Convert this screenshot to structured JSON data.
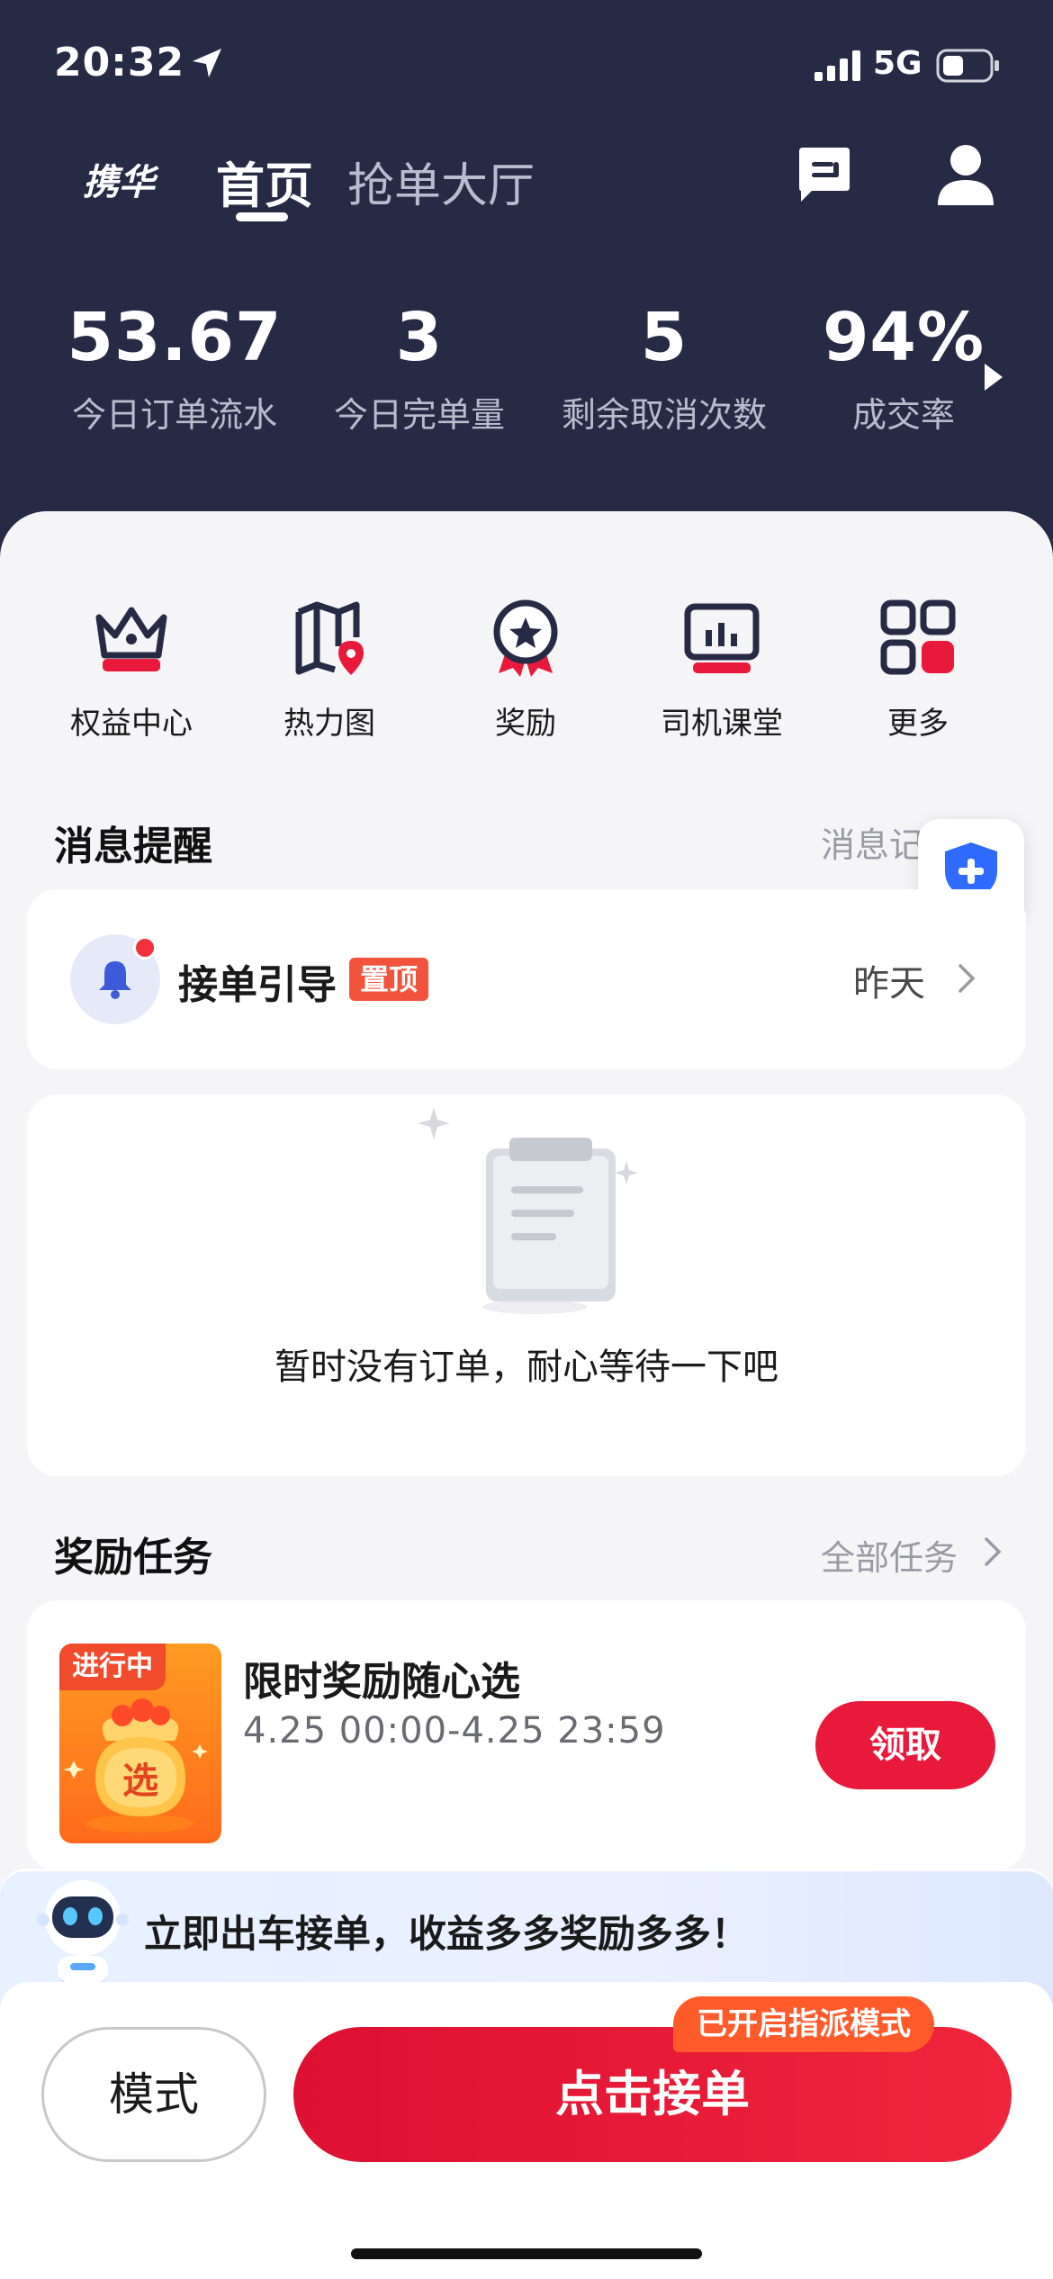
{
  "status_bar": {
    "time": "20:32",
    "network": "5G"
  },
  "nav": {
    "brand": "携华",
    "tab_home": "首页",
    "tab_hall": "抢单大厅"
  },
  "stats": [
    {
      "value": "53.67",
      "label": "今日订单流水"
    },
    {
      "value": "3",
      "label": "今日完单量"
    },
    {
      "value": "5",
      "label": "剩余取消次数"
    },
    {
      "value": "94%",
      "label": "成交率"
    }
  ],
  "quick_menu": [
    {
      "label": "权益中心",
      "icon": "crown-icon"
    },
    {
      "label": "热力图",
      "icon": "map-pin-icon"
    },
    {
      "label": "奖励",
      "icon": "medal-icon"
    },
    {
      "label": "司机课堂",
      "icon": "classroom-icon"
    },
    {
      "label": "更多",
      "icon": "grid-icon"
    }
  ],
  "messages": {
    "title": "消息提醒",
    "link": "消息记录",
    "item": {
      "title": "接单引导",
      "badge": "置顶",
      "time": "昨天"
    }
  },
  "orders": {
    "empty_text": "暂时没有订单，耐心等待一下吧"
  },
  "tasks": {
    "title": "奖励任务",
    "link": "全部任务",
    "item": {
      "tag": "进行中",
      "thumb_text": "选",
      "title": "限时奖励随心选",
      "date": "4.25 00:00-4.25 23:59",
      "button": "领取"
    }
  },
  "banner": {
    "text": "立即出车接单，收益多多奖励多多！"
  },
  "bottom": {
    "mode_label": "模式",
    "accept_label": "点击接单",
    "dispatch_badge": "已开启指派模式"
  },
  "colors": {
    "header_bg": "#272a45",
    "accent_red": "#e8193a",
    "badge_orange": "#f2533c",
    "shield_blue": "#2f6bff"
  }
}
